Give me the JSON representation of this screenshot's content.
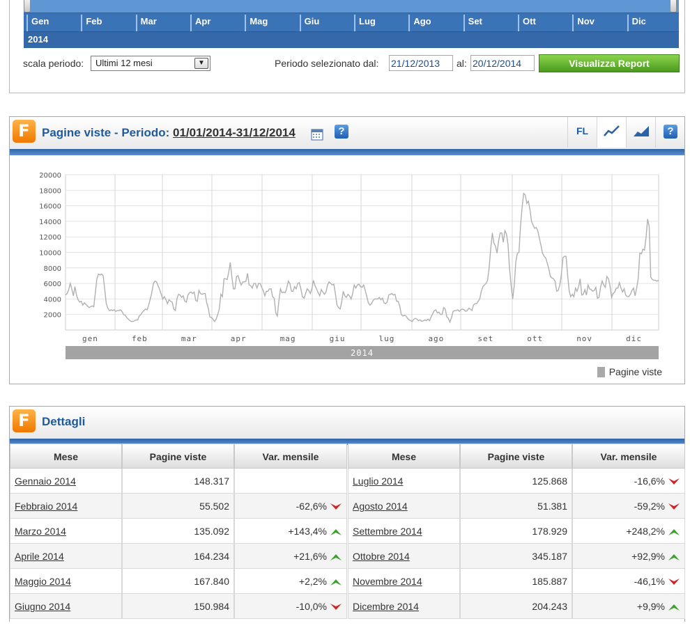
{
  "timeline": {
    "months": [
      "Gen",
      "Feb",
      "Mar",
      "Apr",
      "Mag",
      "Giu",
      "Lug",
      "Ago",
      "Set",
      "Ott",
      "Nov",
      "Dic"
    ],
    "year": "2014"
  },
  "controls": {
    "scale_label": "scala periodo:",
    "scale_value": "Ultimi 12 mesi",
    "period_label": "Periodo selezionato dal:",
    "from_date": "21/12/2013",
    "to_label": "al:",
    "to_date": "20/12/2014",
    "report_button": "Visualizza Report"
  },
  "chart_panel": {
    "logo_letter": "F",
    "title_prefix": "Pagine viste - Periodo:",
    "title_period": "01/01/2014-31/12/2014",
    "help_glyph": "?",
    "fl_label": "FL",
    "icons": [
      "calendar-icon",
      "help-icon",
      "line-chart-icon",
      "area-chart-icon"
    ]
  },
  "chart_data": {
    "type": "line",
    "yticks": [
      2000,
      4000,
      6000,
      8000,
      10000,
      12000,
      14000,
      16000,
      18000,
      20000
    ],
    "ylim": [
      0,
      20000
    ],
    "month_labels": [
      "gen",
      "feb",
      "mar",
      "apr",
      "mag",
      "giu",
      "lug",
      "ago",
      "set",
      "ott",
      "nov",
      "dic"
    ],
    "year_label": "2014",
    "series": [
      {
        "name": "Pagine viste",
        "color": "#b0b0b0",
        "values": [
          4500,
          4700,
          5200,
          6000,
          5300,
          4400,
          5600,
          4500,
          3900,
          3600,
          3700,
          3200,
          3500,
          3300,
          3100,
          2900,
          3000,
          3100,
          3000,
          4800,
          6600,
          7200,
          7100,
          7200,
          7000,
          5200,
          3400,
          2800,
          2500,
          2600,
          2500,
          2600,
          2400,
          2500,
          2500,
          2600,
          2400,
          2000,
          1900,
          1600,
          1400,
          1200,
          1100,
          1100,
          1200,
          1300,
          1300,
          1800,
          2000,
          2300,
          2500,
          2700,
          2600,
          3200,
          4000,
          4800,
          6000,
          6300,
          6200,
          5700,
          5200,
          4600,
          4000,
          4300,
          3900,
          3400,
          3900,
          3700,
          3600,
          2700,
          2500,
          4000,
          4600,
          4500,
          4200,
          4400,
          3700,
          3600,
          4500,
          4800,
          4900,
          4700,
          4900,
          3800,
          3700,
          5100,
          4700,
          4600,
          4700,
          4700,
          3500,
          2800,
          1700,
          1600,
          1400,
          1100,
          1400,
          2000,
          2700,
          4600,
          4300,
          6600,
          6600,
          6500,
          7400,
          8700,
          6900,
          5300,
          5300,
          6900,
          7000,
          6300,
          5800,
          6200,
          6200,
          6300,
          7300,
          5800,
          5700,
          5400,
          6000,
          6000,
          5400,
          6000,
          6000,
          5500,
          5100,
          4400,
          5000,
          5000,
          5300,
          5300,
          4300,
          4100,
          2200,
          1800,
          3800,
          5300,
          4800,
          4900,
          4800,
          5400,
          6300,
          6000,
          5000,
          5000,
          5600,
          5300,
          6000,
          6100,
          5300,
          4300,
          4100,
          4700,
          5300,
          5100,
          4700,
          5300,
          6400,
          5700,
          5300,
          4800,
          4400,
          5200,
          4900,
          4600,
          4900,
          5800,
          6200,
          6000,
          5800,
          5900,
          4700,
          3200,
          2900,
          2700,
          3600,
          5000,
          4400,
          4200,
          4600,
          4400,
          4000,
          4700,
          5800,
          5400,
          5800,
          5900,
          5600,
          5500,
          5800,
          5100,
          4300,
          3500,
          3200,
          3400,
          3800,
          4000,
          4000,
          4000,
          4200,
          3900,
          4100,
          3500,
          3400,
          3600,
          4500,
          4600,
          4700,
          4500,
          4600,
          3700,
          3700,
          3100,
          2000,
          1800,
          1900,
          1800,
          1500,
          1300,
          1200,
          1100,
          1400,
          1500,
          1400,
          1200,
          1300,
          1100,
          1200,
          1300,
          1200,
          1400,
          1200,
          1700,
          2100,
          2500,
          2600,
          2200,
          2300,
          2000,
          2000,
          2900,
          2700,
          1700,
          1500,
          1000,
          1600,
          2400,
          2500,
          2500,
          2600,
          2400,
          2600,
          2700,
          2600,
          2400,
          2500,
          2800,
          2700,
          2500,
          3200,
          3400,
          3400,
          3700,
          4000,
          5000,
          5600,
          5800,
          6000,
          6400,
          8100,
          10500,
          12500,
          11200,
          10800,
          9900,
          11500,
          12500,
          12500,
          11300,
          12800,
          12400,
          11000,
          7900,
          5700,
          4000,
          5800,
          8800,
          9900,
          10000,
          13500,
          15800,
          17600,
          17400,
          16300,
          16600,
          15500,
          14000,
          13500,
          13100,
          13200,
          12800,
          11800,
          10900,
          9900,
          9500,
          9300,
          8600,
          7900,
          6900,
          6700,
          6600,
          6300,
          5000,
          5100,
          5800,
          7100,
          9300,
          9500,
          9500,
          7100,
          5000,
          4300,
          4600,
          4300,
          5400,
          5000,
          5600,
          6600,
          4500,
          4600,
          5200,
          4500,
          5800,
          5300,
          5200,
          5000,
          5100,
          5500,
          4100,
          4200,
          5500,
          6300,
          5800,
          5500,
          6900,
          6600,
          5700,
          4200,
          4700,
          4900,
          5400,
          5400,
          6100,
          5400,
          4900,
          5300,
          4500,
          4300,
          4300,
          4600,
          5100,
          5400,
          4400,
          5400,
          6600,
          9900,
          9800,
          10400,
          10300,
          12000,
          14300,
          13300,
          6800,
          6500,
          6400,
          6400,
          6300,
          6400
        ]
      }
    ],
    "legend": "top-right"
  },
  "details_panel": {
    "logo_letter": "F",
    "title": "Dettagli",
    "headers": [
      "Mese",
      "Pagine viste",
      "Var. mensile"
    ],
    "left_rows": [
      {
        "month": "Gennaio 2014",
        "views": "148.317",
        "var": "",
        "trend": "none"
      },
      {
        "month": "Febbraio 2014",
        "views": "55.502",
        "var": "-62,6%",
        "trend": "down"
      },
      {
        "month": "Marzo 2014",
        "views": "135.092",
        "var": "+143,4%",
        "trend": "up"
      },
      {
        "month": "Aprile 2014",
        "views": "164.234",
        "var": "+21,6%",
        "trend": "up"
      },
      {
        "month": "Maggio 2014",
        "views": "167.840",
        "var": "+2,2%",
        "trend": "up"
      },
      {
        "month": "Giugno 2014",
        "views": "150.984",
        "var": "-10,0%",
        "trend": "down"
      }
    ],
    "right_rows": [
      {
        "month": "Luglio 2014",
        "views": "125.868",
        "var": "-16,6%",
        "trend": "down"
      },
      {
        "month": "Agosto 2014",
        "views": "51.381",
        "var": "-59,2%",
        "trend": "down"
      },
      {
        "month": "Settembre 2014",
        "views": "178.929",
        "var": "+248,2%",
        "trend": "up"
      },
      {
        "month": "Ottobre 2014",
        "views": "345.187",
        "var": "+92,9%",
        "trend": "up"
      },
      {
        "month": "Novembre 2014",
        "views": "185.887",
        "var": "-46,1%",
        "trend": "down"
      },
      {
        "month": "Dicembre 2014",
        "views": "204.243",
        "var": "+9,9%",
        "trend": "up"
      }
    ],
    "trend_colors": {
      "up": "#3ea02c",
      "down": "#d42222"
    }
  }
}
